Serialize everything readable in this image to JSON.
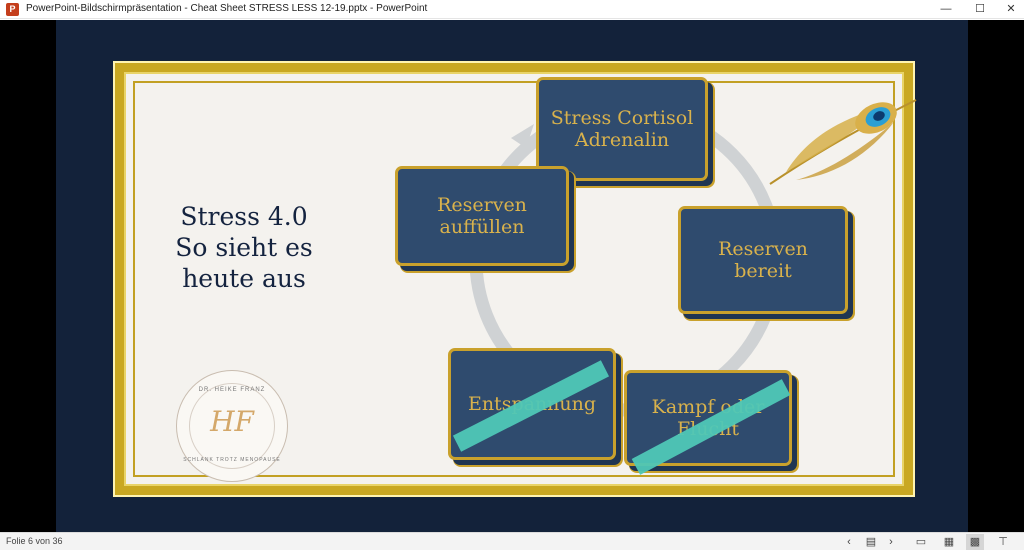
{
  "window": {
    "title": "PowerPoint-Bildschirmpräsentation  -  Cheat Sheet STRESS LESS 12-19.pptx - PowerPoint",
    "app_icon_glyph": "P",
    "min_glyph": "—",
    "max_glyph": "☐",
    "close_glyph": "✕"
  },
  "slide": {
    "title": "Stress 4.0\nSo sieht es\nheute aus",
    "boxes": {
      "stress": "Stress Cortisol\nAdrenalin",
      "reserven_auffuellen": "Reserven\nauffüllen",
      "reserven_bereit": "Reserven\nbereit",
      "entspannung": "Entspannung",
      "kampf_flucht": "Kampf oder\nFlucht"
    },
    "seal": {
      "top_text": "DR. HEIKE FRANZ",
      "monogram": "HF",
      "bottom_text": "SCHLANK TROTZ MENOPAUSE"
    },
    "colors": {
      "slide_bg": "#13223a",
      "card_bg": "#f4f2ee",
      "gold": "#c9a12c",
      "box_fill": "#2f4b6e",
      "strike": "#4fc7b6"
    }
  },
  "statusbar": {
    "slide_counter": "Folie 6 von 36",
    "prev_glyph": "‹",
    "menu_glyph": "▤",
    "next_glyph": "›",
    "normal_glyph": "▭",
    "sorter_glyph": "▦",
    "reading_glyph": "▩",
    "slideshow_glyph": "⊤"
  }
}
